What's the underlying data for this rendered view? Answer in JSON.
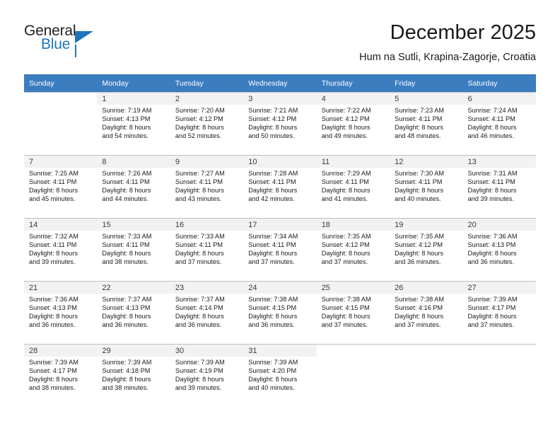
{
  "brand": {
    "name_part1": "General",
    "name_part2": "Blue",
    "accent_color": "#1f76bd",
    "logo_icon": "triangle-flag-icon"
  },
  "header": {
    "title": "December 2025",
    "subtitle": "Hum na Sutli, Krapina-Zagorje, Croatia"
  },
  "calendar": {
    "header_background": "#3c7dbf",
    "weekdays": [
      "Sunday",
      "Monday",
      "Tuesday",
      "Wednesday",
      "Thursday",
      "Friday",
      "Saturday"
    ],
    "weeks": [
      [
        {
          "empty": true
        },
        {
          "day": "1",
          "sunrise": "Sunrise: 7:19 AM",
          "sunset": "Sunset: 4:13 PM",
          "daylight1": "Daylight: 8 hours",
          "daylight2": "and 54 minutes."
        },
        {
          "day": "2",
          "sunrise": "Sunrise: 7:20 AM",
          "sunset": "Sunset: 4:12 PM",
          "daylight1": "Daylight: 8 hours",
          "daylight2": "and 52 minutes."
        },
        {
          "day": "3",
          "sunrise": "Sunrise: 7:21 AM",
          "sunset": "Sunset: 4:12 PM",
          "daylight1": "Daylight: 8 hours",
          "daylight2": "and 50 minutes."
        },
        {
          "day": "4",
          "sunrise": "Sunrise: 7:22 AM",
          "sunset": "Sunset: 4:12 PM",
          "daylight1": "Daylight: 8 hours",
          "daylight2": "and 49 minutes."
        },
        {
          "day": "5",
          "sunrise": "Sunrise: 7:23 AM",
          "sunset": "Sunset: 4:11 PM",
          "daylight1": "Daylight: 8 hours",
          "daylight2": "and 48 minutes."
        },
        {
          "day": "6",
          "sunrise": "Sunrise: 7:24 AM",
          "sunset": "Sunset: 4:11 PM",
          "daylight1": "Daylight: 8 hours",
          "daylight2": "and 46 minutes."
        }
      ],
      [
        {
          "day": "7",
          "sunrise": "Sunrise: 7:25 AM",
          "sunset": "Sunset: 4:11 PM",
          "daylight1": "Daylight: 8 hours",
          "daylight2": "and 45 minutes."
        },
        {
          "day": "8",
          "sunrise": "Sunrise: 7:26 AM",
          "sunset": "Sunset: 4:11 PM",
          "daylight1": "Daylight: 8 hours",
          "daylight2": "and 44 minutes."
        },
        {
          "day": "9",
          "sunrise": "Sunrise: 7:27 AM",
          "sunset": "Sunset: 4:11 PM",
          "daylight1": "Daylight: 8 hours",
          "daylight2": "and 43 minutes."
        },
        {
          "day": "10",
          "sunrise": "Sunrise: 7:28 AM",
          "sunset": "Sunset: 4:11 PM",
          "daylight1": "Daylight: 8 hours",
          "daylight2": "and 42 minutes."
        },
        {
          "day": "11",
          "sunrise": "Sunrise: 7:29 AM",
          "sunset": "Sunset: 4:11 PM",
          "daylight1": "Daylight: 8 hours",
          "daylight2": "and 41 minutes."
        },
        {
          "day": "12",
          "sunrise": "Sunrise: 7:30 AM",
          "sunset": "Sunset: 4:11 PM",
          "daylight1": "Daylight: 8 hours",
          "daylight2": "and 40 minutes."
        },
        {
          "day": "13",
          "sunrise": "Sunrise: 7:31 AM",
          "sunset": "Sunset: 4:11 PM",
          "daylight1": "Daylight: 8 hours",
          "daylight2": "and 39 minutes."
        }
      ],
      [
        {
          "day": "14",
          "sunrise": "Sunrise: 7:32 AM",
          "sunset": "Sunset: 4:11 PM",
          "daylight1": "Daylight: 8 hours",
          "daylight2": "and 39 minutes."
        },
        {
          "day": "15",
          "sunrise": "Sunrise: 7:33 AM",
          "sunset": "Sunset: 4:11 PM",
          "daylight1": "Daylight: 8 hours",
          "daylight2": "and 38 minutes."
        },
        {
          "day": "16",
          "sunrise": "Sunrise: 7:33 AM",
          "sunset": "Sunset: 4:11 PM",
          "daylight1": "Daylight: 8 hours",
          "daylight2": "and 37 minutes."
        },
        {
          "day": "17",
          "sunrise": "Sunrise: 7:34 AM",
          "sunset": "Sunset: 4:11 PM",
          "daylight1": "Daylight: 8 hours",
          "daylight2": "and 37 minutes."
        },
        {
          "day": "18",
          "sunrise": "Sunrise: 7:35 AM",
          "sunset": "Sunset: 4:12 PM",
          "daylight1": "Daylight: 8 hours",
          "daylight2": "and 37 minutes."
        },
        {
          "day": "19",
          "sunrise": "Sunrise: 7:35 AM",
          "sunset": "Sunset: 4:12 PM",
          "daylight1": "Daylight: 8 hours",
          "daylight2": "and 36 minutes."
        },
        {
          "day": "20",
          "sunrise": "Sunrise: 7:36 AM",
          "sunset": "Sunset: 4:13 PM",
          "daylight1": "Daylight: 8 hours",
          "daylight2": "and 36 minutes."
        }
      ],
      [
        {
          "day": "21",
          "sunrise": "Sunrise: 7:36 AM",
          "sunset": "Sunset: 4:13 PM",
          "daylight1": "Daylight: 8 hours",
          "daylight2": "and 36 minutes."
        },
        {
          "day": "22",
          "sunrise": "Sunrise: 7:37 AM",
          "sunset": "Sunset: 4:13 PM",
          "daylight1": "Daylight: 8 hours",
          "daylight2": "and 36 minutes."
        },
        {
          "day": "23",
          "sunrise": "Sunrise: 7:37 AM",
          "sunset": "Sunset: 4:14 PM",
          "daylight1": "Daylight: 8 hours",
          "daylight2": "and 36 minutes."
        },
        {
          "day": "24",
          "sunrise": "Sunrise: 7:38 AM",
          "sunset": "Sunset: 4:15 PM",
          "daylight1": "Daylight: 8 hours",
          "daylight2": "and 36 minutes."
        },
        {
          "day": "25",
          "sunrise": "Sunrise: 7:38 AM",
          "sunset": "Sunset: 4:15 PM",
          "daylight1": "Daylight: 8 hours",
          "daylight2": "and 37 minutes."
        },
        {
          "day": "26",
          "sunrise": "Sunrise: 7:38 AM",
          "sunset": "Sunset: 4:16 PM",
          "daylight1": "Daylight: 8 hours",
          "daylight2": "and 37 minutes."
        },
        {
          "day": "27",
          "sunrise": "Sunrise: 7:39 AM",
          "sunset": "Sunset: 4:17 PM",
          "daylight1": "Daylight: 8 hours",
          "daylight2": "and 37 minutes."
        }
      ],
      [
        {
          "day": "28",
          "sunrise": "Sunrise: 7:39 AM",
          "sunset": "Sunset: 4:17 PM",
          "daylight1": "Daylight: 8 hours",
          "daylight2": "and 38 minutes."
        },
        {
          "day": "29",
          "sunrise": "Sunrise: 7:39 AM",
          "sunset": "Sunset: 4:18 PM",
          "daylight1": "Daylight: 8 hours",
          "daylight2": "and 38 minutes."
        },
        {
          "day": "30",
          "sunrise": "Sunrise: 7:39 AM",
          "sunset": "Sunset: 4:19 PM",
          "daylight1": "Daylight: 8 hours",
          "daylight2": "and 39 minutes."
        },
        {
          "day": "31",
          "sunrise": "Sunrise: 7:39 AM",
          "sunset": "Sunset: 4:20 PM",
          "daylight1": "Daylight: 8 hours",
          "daylight2": "and 40 minutes."
        },
        {
          "empty": true
        },
        {
          "empty": true
        },
        {
          "empty": true
        }
      ]
    ]
  }
}
